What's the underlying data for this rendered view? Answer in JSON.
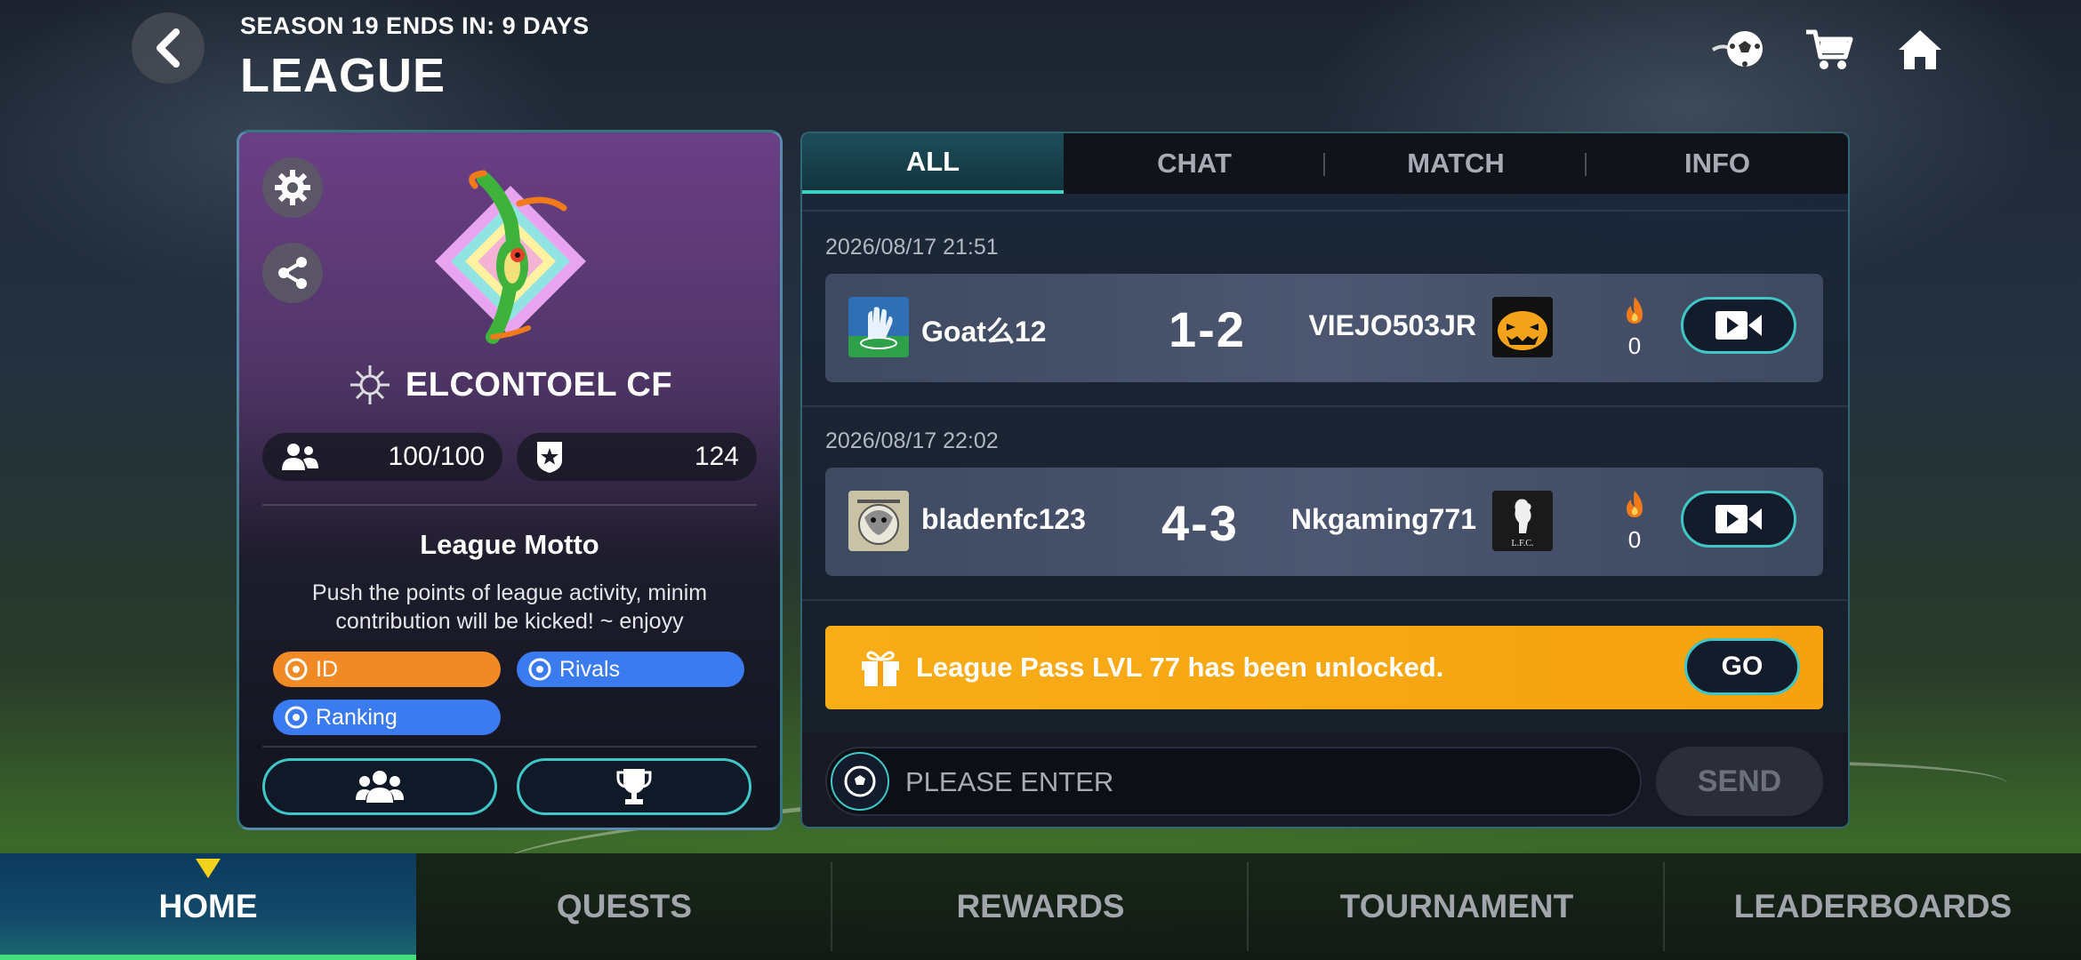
{
  "header": {
    "season_text": "SEASON 19 ENDS IN: 9 DAYS",
    "title": "LEAGUE"
  },
  "icons": {
    "back": "back-chevron-icon",
    "top_right": [
      "ball-icon",
      "cart-icon",
      "home-icon"
    ],
    "side": [
      "gear-icon",
      "share-icon"
    ]
  },
  "club": {
    "name": "ELCONTOEL CF",
    "members": "100/100",
    "rank": "124",
    "motto_title": "League Motto",
    "motto_text": "Push the points of league activity, minim contribution will be kicked! ~ enjoyy",
    "chips": [
      "ID",
      "Rivals",
      "Ranking"
    ]
  },
  "tabs": [
    "ALL",
    "CHAT",
    "MATCH",
    "INFO"
  ],
  "matches": [
    {
      "time": "2026/08/17 21:51",
      "home": "Goat么12",
      "score": "1-2",
      "away": "VIEJO503JR",
      "heat": "0"
    },
    {
      "time": "2026/08/17 22:02",
      "home": "bladenfc123",
      "score": "4-3",
      "away": "Nkgaming771",
      "heat": "0",
      "away_logo_text": "L.F.C."
    }
  ],
  "pass_banner": {
    "text": "League Pass LVL 77 has been unlocked.",
    "button": "GO"
  },
  "chat_input": {
    "placeholder": "PLEASE ENTER",
    "send": "SEND"
  },
  "bottom_nav": [
    "HOME",
    "QUESTS",
    "REWARDS",
    "TOURNAMENT",
    "LEADERBOARDS"
  ],
  "colors": {
    "accent_teal": "#3fc6c6",
    "banner_orange": "#f6a20f",
    "chip_orange": "#f08a24",
    "chip_blue": "#3a7bf0",
    "fire": "#f07a1a"
  }
}
